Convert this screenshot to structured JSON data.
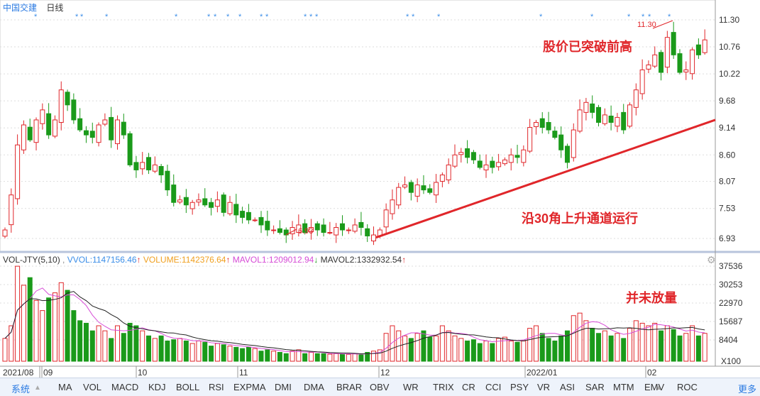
{
  "header": {
    "stock": "中国交建",
    "period": "日线"
  },
  "chart_data": [
    {
      "type": "candlestick",
      "title": "中国交建 日线",
      "ylim": [
        6.6,
        11.5
      ],
      "y_ticks": [
        "11.30",
        "10.76",
        "10.22",
        "9.68",
        "9.14",
        "8.60",
        "8.07",
        "7.53",
        "6.93"
      ],
      "x_ticks": [
        "2021/08",
        "09",
        "10",
        "11",
        "12",
        "2022/01",
        "02"
      ],
      "high_label": "11.30",
      "low_label": "6.93",
      "closes": [
        7.1,
        7.8,
        8.8,
        9.2,
        8.9,
        9.3,
        9.5,
        9.0,
        9.3,
        9.9,
        9.6,
        9.3,
        9.1,
        9.0,
        8.95,
        9.2,
        9.3,
        8.9,
        9.3,
        9.0,
        8.4,
        8.3,
        8.45,
        8.3,
        8.4,
        8.2,
        7.9,
        7.65,
        7.7,
        7.6,
        7.65,
        7.7,
        7.6,
        7.55,
        7.7,
        7.45,
        7.65,
        7.4,
        7.35,
        7.3,
        7.3,
        7.2,
        7.1,
        7.1,
        7.05,
        7.0,
        7.15,
        7.2,
        7.05,
        7.15,
        7.1,
        7.05,
        7.05,
        7.15,
        7.1,
        7.1,
        7.2,
        7.15,
        6.98,
        7.0,
        7.1,
        7.5,
        7.7,
        7.95,
        8.0,
        7.85,
        8.0,
        7.9,
        7.85,
        8.05,
        8.2,
        8.4,
        8.6,
        8.65,
        8.55,
        8.5,
        8.35,
        8.4,
        8.35,
        8.45,
        8.5,
        8.6,
        8.55,
        8.7,
        9.15,
        9.25,
        9.15,
        9.1,
        8.95,
        8.7,
        8.45,
        9.1,
        9.5,
        9.65,
        9.45,
        9.25,
        9.4,
        9.25,
        9.35,
        9.1,
        9.6,
        9.9,
        10.3,
        10.4,
        10.6,
        10.25,
        10.95,
        10.6,
        10.25,
        10.3,
        10.7,
        10.6,
        10.9
      ],
      "annotations": [
        "股价已突破前高",
        "沿30角上升通道运行",
        "并未放量"
      ],
      "trendline": {
        "from_price": 6.95,
        "to_price": 9.3
      }
    },
    {
      "type": "bar",
      "title": "VOL-JTY(5,10)",
      "legend": {
        "name": "VOL-JTY(5,10)",
        "vvol": "VVOL:1147156.46",
        "volume": "VOLUME:1142376.64",
        "mavol1": "MAVOL1:1209012.94",
        "mavol2": "MAVOL2:1332932.54"
      },
      "y_ticks": [
        "37536",
        "30253",
        "22970",
        "15687",
        "8404"
      ],
      "unit": "X100",
      "volumes": [
        9000,
        14000,
        37500,
        30000,
        33000,
        24000,
        20000,
        25000,
        27000,
        31000,
        28000,
        20000,
        16000,
        15000,
        12000,
        14000,
        12000,
        9000,
        14000,
        11000,
        15000,
        14000,
        12000,
        10000,
        9000,
        10000,
        8000,
        8500,
        9000,
        8000,
        7000,
        8000,
        7500,
        6000,
        7000,
        6500,
        6000,
        5500,
        5000,
        5500,
        5000,
        4000,
        4500,
        4000,
        3500,
        3000,
        4000,
        4500,
        3000,
        3500,
        3000,
        3000,
        2800,
        3000,
        2800,
        2700,
        3000,
        2500,
        3500,
        4000,
        4500,
        11000,
        14000,
        12000,
        10000,
        9000,
        11000,
        12000,
        9500,
        10000,
        14000,
        12000,
        10000,
        9000,
        8000,
        8500,
        7000,
        8000,
        7000,
        9000,
        9500,
        8000,
        7500,
        8000,
        13000,
        14000,
        11000,
        9000,
        8000,
        10000,
        12000,
        18000,
        19000,
        16000,
        13000,
        11000,
        12000,
        10000,
        11000,
        9000,
        13000,
        16000,
        15000,
        14000,
        15000,
        12000,
        14000,
        12500,
        10000,
        11000,
        14000,
        10000,
        11000
      ]
    }
  ],
  "toolbar": {
    "system": "系统",
    "items": [
      "MA",
      "VOL",
      "MACD",
      "KDJ",
      "BOLL",
      "RSI",
      "EXPMA",
      "DMI",
      "DMA",
      "BRAR",
      "OBV",
      "WR",
      "TRIX",
      "CR",
      "CCI",
      "PSY",
      "VR",
      "ASI",
      "SAR",
      "MTM",
      "EMV",
      "ROC"
    ],
    "more": "更多"
  },
  "colors": {
    "up": "#e0262a",
    "down": "#1a9a1a",
    "accent": "#2a7ae2"
  }
}
